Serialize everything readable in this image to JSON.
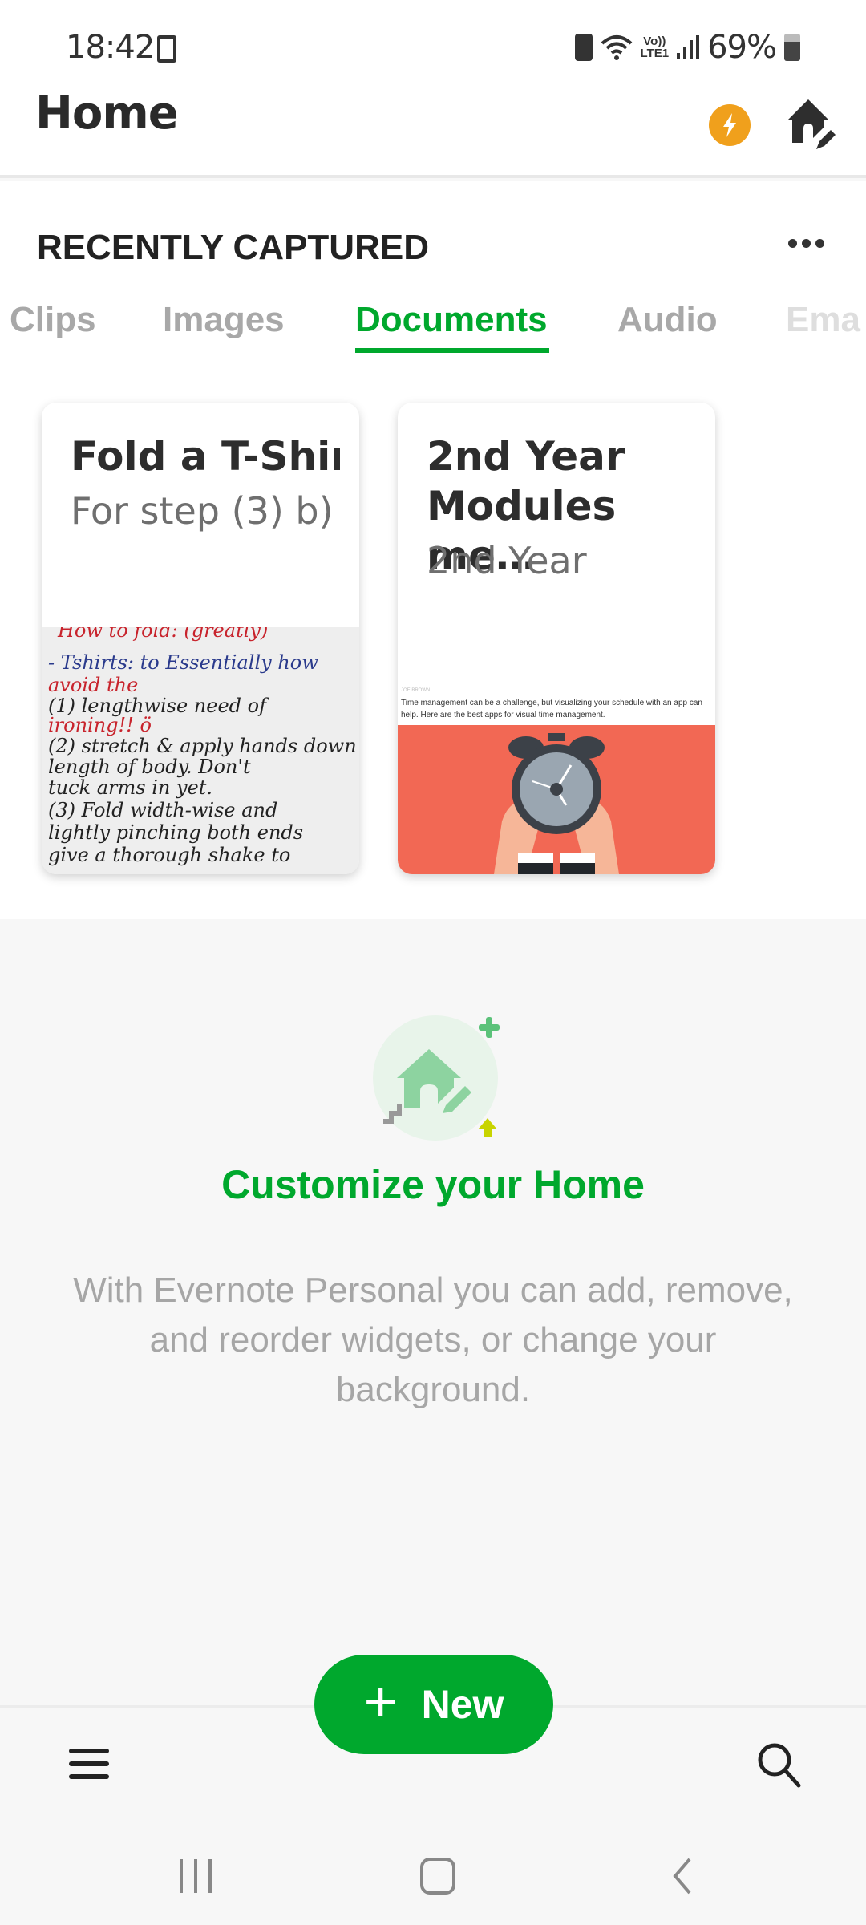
{
  "status_bar": {
    "time": "18:42",
    "network_label_top": "Vo))",
    "network_label_bottom": "LTE1",
    "battery_percent": "69%",
    "icons": [
      "music-device-icon",
      "battery-saver-icon",
      "wifi-icon",
      "volte-icon",
      "signal-icon",
      "battery-icon"
    ]
  },
  "header": {
    "title": "Home",
    "icons": [
      "lightning-bolt-icon",
      "home-edit-icon"
    ]
  },
  "recently_captured": {
    "title": "RECENTLY CAPTURED",
    "more_icon": "more-horizontal-icon",
    "tabs": [
      {
        "label": "Clips",
        "active": false
      },
      {
        "label": "Images",
        "active": false
      },
      {
        "label": "Documents",
        "active": true
      },
      {
        "label": "Audio",
        "active": false
      },
      {
        "label": "Ema",
        "active": false
      }
    ],
    "cards": [
      {
        "title": "Fold a T-Shir..",
        "subtitle": "For step (3) b)",
        "thumbnail_lines": [
          "How to fold: (greatly)",
          "- Tshirts:   to  Essentially how",
          "               avoid the",
          "(1) lengthwise  need of",
          "                ironing!! ö",
          "(2) stretch & apply hands down",
          "    length of body. Don't",
          "    tuck arms in yet.",
          "(3) Fold   width-wise and",
          "lightly pinching both ends",
          "give a thorough shake to"
        ]
      },
      {
        "title": "2nd Year Modules me…",
        "subtitle": "2nd Year",
        "thumbnail_author": "JOE BROWN",
        "thumbnail_text": "Time management can be a challenge, but visualizing your schedule with an app can help. Here are the best apps for visual time management."
      }
    ]
  },
  "customize": {
    "title": "Customize your Home",
    "description": "With Evernote Personal you can add, remove, and reorder widgets, or change your background."
  },
  "bottom_bar": {
    "new_button_label": "New",
    "icons": [
      "menu-icon",
      "search-icon"
    ]
  },
  "nav_bar": {
    "icons": [
      "recents-icon",
      "home-icon",
      "back-icon"
    ]
  },
  "colors": {
    "accent_green": "#00a82d",
    "bolt_orange": "#f0a01c",
    "article_red": "#f26854"
  }
}
